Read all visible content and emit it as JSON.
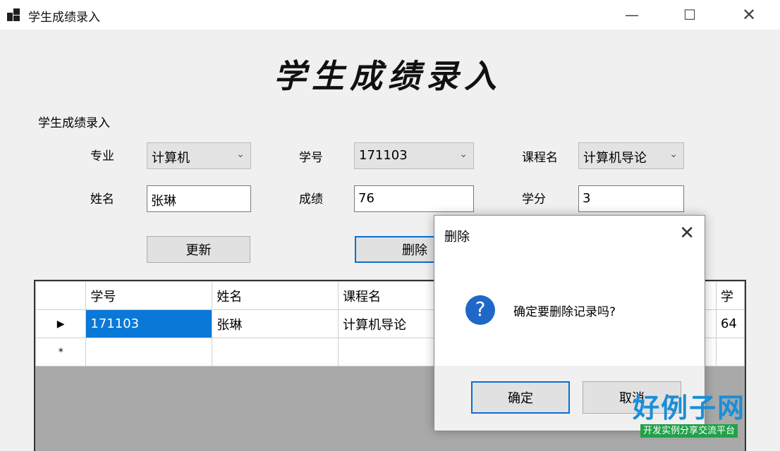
{
  "window": {
    "title": "学生成绩录入"
  },
  "header": {
    "big_title": "学生成绩录入"
  },
  "form": {
    "section_label": "学生成绩录入",
    "major_label": "专业",
    "major_value": "计算机",
    "student_id_label": "学号",
    "student_id_value": "171103",
    "course_label": "课程名",
    "course_value": "计算机导论",
    "name_label": "姓名",
    "name_value": "张琳",
    "score_label": "成绩",
    "score_value": "76",
    "credit_label": "学分",
    "credit_value": "3",
    "update_label": "更新",
    "delete_label": "删除"
  },
  "grid": {
    "columns": [
      "学号",
      "姓名",
      "课程名",
      "学"
    ],
    "rows": [
      {
        "cells": [
          "171103",
          "张琳",
          "计算机导论",
          "64"
        ]
      }
    ],
    "new_row_marker": "*"
  },
  "dialog": {
    "title": "删除",
    "message": "确定要删除记录吗?",
    "ok_label": "确定",
    "cancel_label": "取消"
  },
  "watermark": {
    "logo_text": "好例子网",
    "logo_sub": "开发实例分享交流平台"
  },
  "colors": {
    "accent": "#0a78d7",
    "question_icon": "#1f68c8"
  }
}
